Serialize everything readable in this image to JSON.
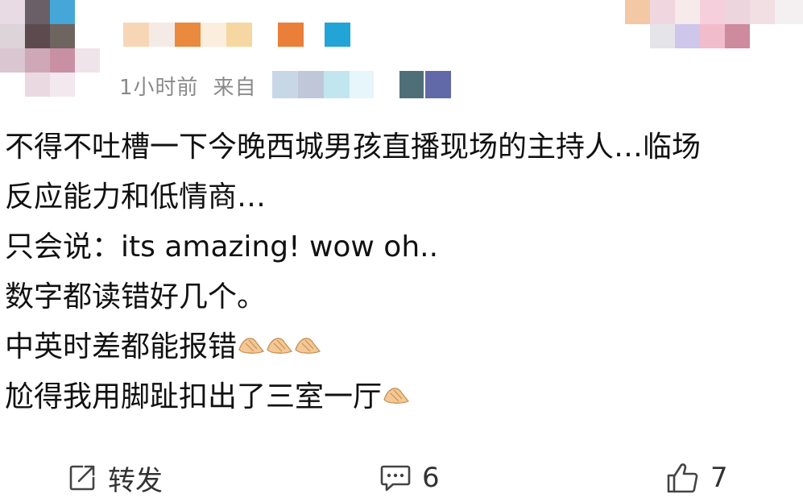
{
  "comment": {
    "time_label": "1小时前",
    "source_prefix": "来自",
    "lines": [
      "不得不吐槽一下今晚西城男孩直播现场的主持人…临场",
      "反应能力和低情商…",
      "只会说：its amazing! wow oh..",
      "数字都读错好几个。",
      "中英时差都能报错",
      "尬得我用脚趾扣出了三室一厅"
    ],
    "emoji_line_4": [
      "palms-up-hand-emoji",
      "palms-up-hand-emoji",
      "palms-up-hand-emoji"
    ],
    "emoji_line_5": [
      "palms-up-hand-emoji"
    ]
  },
  "actions": {
    "repost_label": "转发",
    "comment_count": "6",
    "like_count": "7"
  },
  "icons": {
    "repost": "repost-icon",
    "comment": "comment-icon",
    "like": "like-icon"
  },
  "colors": {
    "meta_text": "#8a8a8a",
    "body_text": "#111111",
    "action_text": "#333333"
  }
}
